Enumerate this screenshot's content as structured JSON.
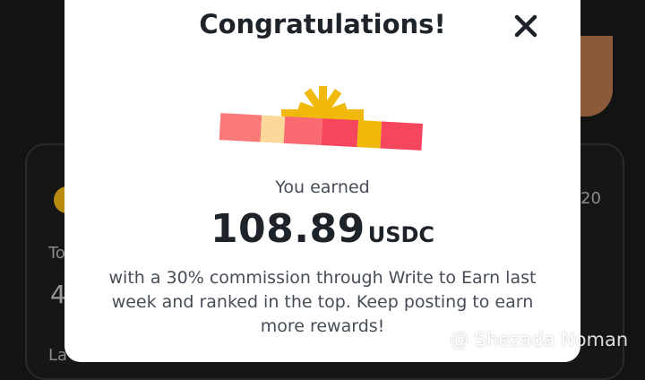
{
  "background": {
    "frag_to": "To",
    "frag_4": "4",
    "frag_la": "La",
    "frag_20": "20"
  },
  "modal": {
    "title": "Congratulations!",
    "close_icon": "close-icon",
    "gift_icon": "gift-box-icon",
    "earned_label": "You earned",
    "amount": "108.89",
    "unit": "USDC",
    "description": "with a 30% commission through Write to Earn last week and ranked in the top. Keep posting to earn more rewards!"
  },
  "watermark": {
    "text": "@ Shezada Noman"
  },
  "colors": {
    "text_primary": "#1e2329",
    "text_secondary": "#474d57",
    "gift_gold": "#f0b90b",
    "gift_red": "#f6465d",
    "gift_pink": "#fa7a7a",
    "gift_cream": "#fcd99a"
  }
}
